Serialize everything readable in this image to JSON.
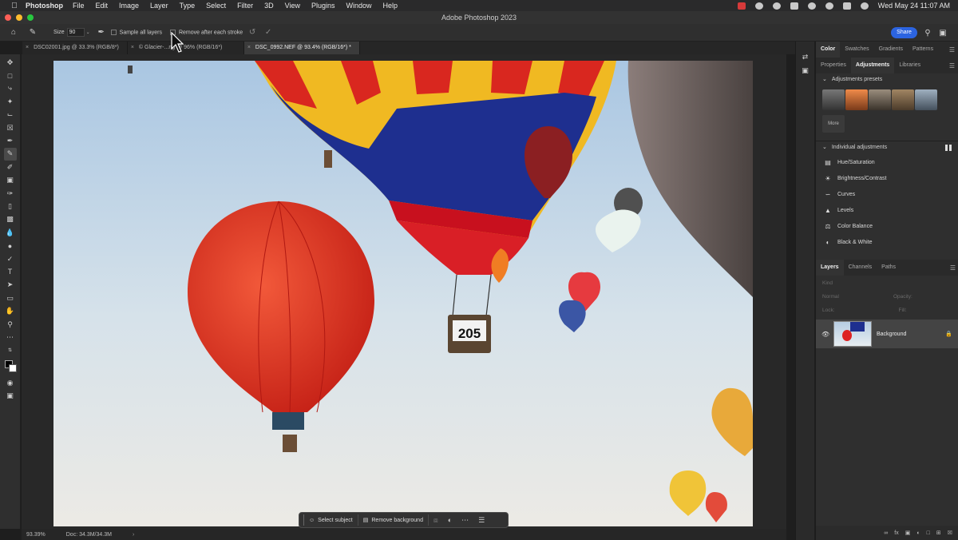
{
  "menubar": {
    "app_name": "Photoshop",
    "items": [
      "File",
      "Edit",
      "Image",
      "Layer",
      "Type",
      "Select",
      "Filter",
      "3D",
      "View",
      "Plugins",
      "Window",
      "Help"
    ],
    "datetime": "Wed May 24  11:07 AM"
  },
  "window": {
    "title": "Adobe Photoshop 2023"
  },
  "options": {
    "size_label": "Size",
    "size_value": "90",
    "sample_all_layers": "Sample all layers",
    "remove_after_stroke": "Remove after each stroke",
    "share_label": "Share"
  },
  "tabs": [
    {
      "label": "DSC02001.jpg @ 33.3% (RGB/8*)"
    },
    {
      "label": "© Glacier-...ng @ 96% (RGB/16*)"
    },
    {
      "label": "DSC_0992.NEF @ 93.4% (RGB/16*) *"
    }
  ],
  "canvas": {
    "basket_number": "205"
  },
  "context_bar": {
    "select_subject": "Select subject",
    "remove_background": "Remove background"
  },
  "status": {
    "zoom": "93.39%",
    "doc": "Doc: 34.3M/34.3M"
  },
  "panels": {
    "top_tabs": [
      "Color",
      "Swatches",
      "Gradients",
      "Patterns"
    ],
    "mid_tabs": [
      "Properties",
      "Adjustments",
      "Libraries"
    ],
    "adjustment_presets": "Adjustments presets",
    "more_label": "More",
    "individual_adjustments": "Individual adjustments",
    "adjustments": [
      {
        "label": "Hue/Saturation",
        "icon": "hue-icon"
      },
      {
        "label": "Brightness/Contrast",
        "icon": "sun-icon"
      },
      {
        "label": "Curves",
        "icon": "curves-icon"
      },
      {
        "label": "Levels",
        "icon": "levels-icon"
      },
      {
        "label": "Color Balance",
        "icon": "balance-icon"
      },
      {
        "label": "Black & White",
        "icon": "bw-icon"
      }
    ],
    "layer_tabs": [
      "Layers",
      "Channels",
      "Paths"
    ],
    "kind_label": "Kind",
    "blend_mode": "Normal",
    "opacity_label": "Opacity:",
    "lock_label": "Lock:",
    "fill_label": "Fill:",
    "layer_name": "Background"
  },
  "colors": {
    "accent": "#2c64e0",
    "brand": "#31a8ff"
  }
}
